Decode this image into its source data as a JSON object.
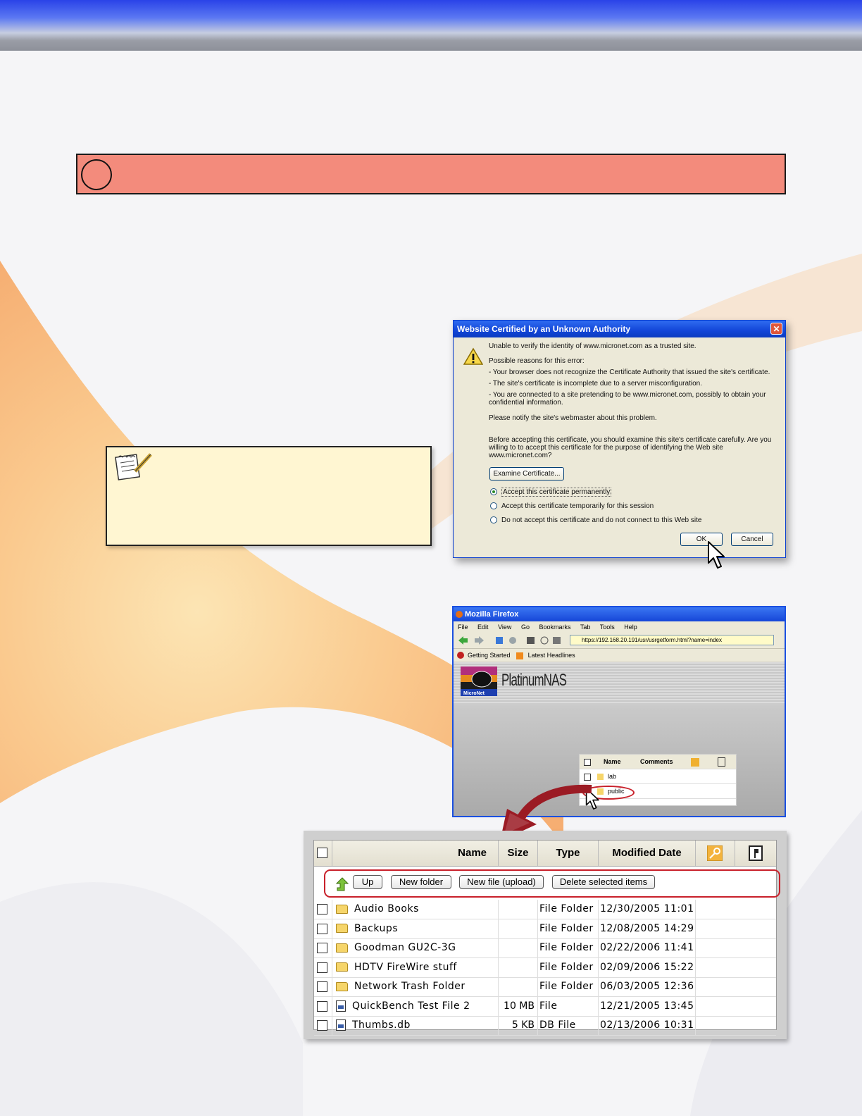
{
  "dialog": {
    "title": "Website Certified by an Unknown Authority",
    "close_glyph": "✕",
    "line1": "Unable to verify the identity of www.micronet.com as a trusted site.",
    "reasons_heading": "Possible reasons for this error:",
    "reason1": "- Your browser does not recognize the Certificate Authority that issued the site's certificate.",
    "reason2": "- The site's certificate is incomplete due to a server misconfiguration.",
    "reason3": "- You are connected to a site pretending to be www.micronet.com, possibly to obtain your confidential information.",
    "notify": "Please notify the site's webmaster about this problem.",
    "before": "Before accepting this certificate, you should examine this site's certificate carefully. Are you willing to to accept this certificate for the purpose of identifying the Web site www.micronet.com?",
    "examine_button": "Examine Certificate...",
    "radio_permanent": "Accept this certificate permanently",
    "radio_temporary": "Accept this certificate temporarily for this session",
    "radio_reject": "Do not accept this certificate and do not connect to this Web site",
    "ok_button": "OK",
    "cancel_button": "Cancel"
  },
  "firefox": {
    "title": "Mozilla Firefox",
    "menu": [
      "File",
      "Edit",
      "View",
      "Go",
      "Bookmarks",
      "Tab",
      "Tools",
      "Help"
    ],
    "url": "https://192.168.20.191/usr/usrgetform.html?name=index",
    "bookmark1": "Getting Started",
    "bookmark2": "Latest Headlines",
    "logo_text": "MicroNet",
    "product_name": "PlatinumNAS",
    "mini_table": {
      "col_name": "Name",
      "col_comments": "Comments",
      "rows": [
        "lab",
        "public"
      ]
    }
  },
  "file_table": {
    "headers": {
      "name": "Name",
      "size": "Size",
      "type": "Type",
      "modified": "Modified Date"
    },
    "toolbar": {
      "up": "Up",
      "new_folder": "New folder",
      "new_file": "New file (upload)",
      "delete": "Delete selected items"
    },
    "rows": [
      {
        "name": "Audio Books",
        "size": "",
        "type": "File Folder",
        "date": "12/30/2005 11:01",
        "icon": "folder"
      },
      {
        "name": "Backups",
        "size": "",
        "type": "File Folder",
        "date": "12/08/2005 14:29",
        "icon": "folder"
      },
      {
        "name": "Goodman GU2C-3G",
        "size": "",
        "type": "File Folder",
        "date": "02/22/2006 11:41",
        "icon": "folder"
      },
      {
        "name": "HDTV FireWire stuff",
        "size": "",
        "type": "File Folder",
        "date": "02/09/2006 15:22",
        "icon": "folder"
      },
      {
        "name": "Network Trash Folder",
        "size": "",
        "type": "File Folder",
        "date": "06/03/2005 12:36",
        "icon": "folder"
      },
      {
        "name": "QuickBench Test File 2",
        "size": "10 MB",
        "type": "File",
        "date": "12/21/2005 13:45",
        "icon": "file"
      },
      {
        "name": "Thumbs.db",
        "size": "5 KB",
        "type": "DB File",
        "date": "02/13/2006 10:31",
        "icon": "file"
      }
    ]
  },
  "colors": {
    "banner": "#f38b7c",
    "note_bg": "#fff6d2",
    "highlight_red": "#c8202a",
    "swoosh_orange": "#f7a24a"
  }
}
